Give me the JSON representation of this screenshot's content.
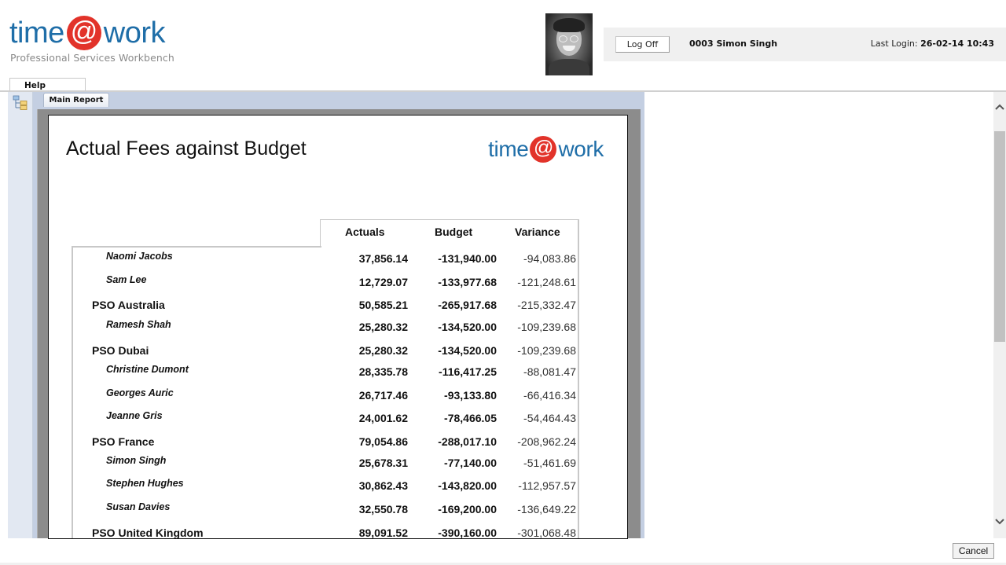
{
  "app": {
    "logo_left": "time",
    "logo_at": "@",
    "logo_right": "work",
    "subtitle": "Professional Services Workbench"
  },
  "user": {
    "logoff_label": "Log Off",
    "name": "0003 Simon Singh",
    "last_login_label": "Last Login:",
    "last_login_value": "26-02-14 10:43"
  },
  "tabs": {
    "help": "Help",
    "main_report": "Main Report"
  },
  "report": {
    "title": "Actual Fees against Budget",
    "logo_left": "time",
    "logo_at": "@",
    "logo_right": "work",
    "columns": [
      "Actuals",
      "Budget",
      "Variance"
    ],
    "rows": [
      {
        "type": "person",
        "name": "Naomi Jacobs",
        "actuals": "37,856.14",
        "budget": "-131,940.00",
        "variance": "-94,083.86"
      },
      {
        "type": "person",
        "name": "Sam Lee",
        "actuals": "12,729.07",
        "budget": "-133,977.68",
        "variance": "-121,248.61"
      },
      {
        "type": "office",
        "name": "PSO Australia",
        "actuals": "50,585.21",
        "budget": "-265,917.68",
        "variance": "-215,332.47"
      },
      {
        "type": "person",
        "name": "Ramesh Shah",
        "actuals": "25,280.32",
        "budget": "-134,520.00",
        "variance": "-109,239.68"
      },
      {
        "type": "office",
        "name": "PSO Dubai",
        "actuals": "25,280.32",
        "budget": "-134,520.00",
        "variance": "-109,239.68"
      },
      {
        "type": "person",
        "name": "Christine Dumont",
        "actuals": "28,335.78",
        "budget": "-116,417.25",
        "variance": "-88,081.47"
      },
      {
        "type": "person",
        "name": "Georges Auric",
        "actuals": "26,717.46",
        "budget": "-93,133.80",
        "variance": "-66,416.34"
      },
      {
        "type": "person",
        "name": "Jeanne Gris",
        "actuals": "24,001.62",
        "budget": "-78,466.05",
        "variance": "-54,464.43"
      },
      {
        "type": "office",
        "name": "PSO France",
        "actuals": "79,054.86",
        "budget": "-288,017.10",
        "variance": "-208,962.24"
      },
      {
        "type": "person",
        "name": "Simon Singh",
        "actuals": "25,678.31",
        "budget": "-77,140.00",
        "variance": "-51,461.69"
      },
      {
        "type": "person",
        "name": "Stephen Hughes",
        "actuals": "30,862.43",
        "budget": "-143,820.00",
        "variance": "-112,957.57"
      },
      {
        "type": "person",
        "name": "Susan Davies",
        "actuals": "32,550.78",
        "budget": "-169,200.00",
        "variance": "-136,649.22"
      },
      {
        "type": "office",
        "name": "PSO United Kingdom",
        "actuals": "89,091.52",
        "budget": "-390,160.00",
        "variance": "-301,068.48"
      }
    ]
  },
  "icons": {
    "tree": "tree-view-icon",
    "scroll_up": "^",
    "scroll_down": "v",
    "scroll_up_glyph": "⌃",
    "scroll_down_glyph": "⌄"
  },
  "footer": {
    "cancel_label": "Cancel"
  },
  "colors": {
    "brand_blue": "#1f6ea8",
    "brand_red": "#e2332a"
  }
}
